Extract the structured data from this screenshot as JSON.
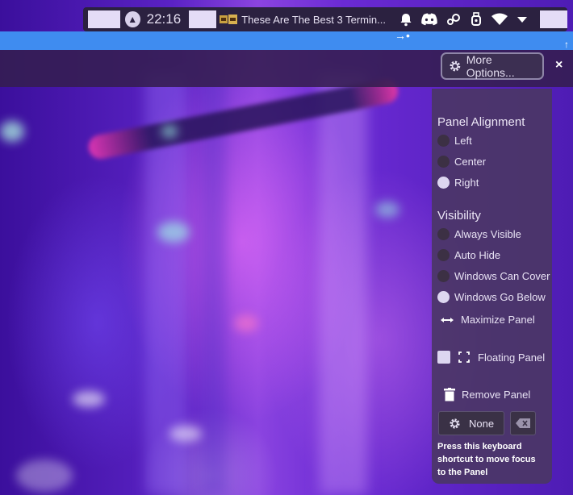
{
  "taskbar": {
    "clock": "22:16",
    "window_title": "These Are The Best 3 Termin...",
    "icons": [
      "launcher-icon",
      "notification-bell-icon",
      "discord-icon",
      "steam-icon",
      "usb-icon",
      "wifi-icon",
      "chevron-down-icon"
    ]
  },
  "toolbar": {
    "more_options_label": "More Options...",
    "close_label": "×"
  },
  "panel_options": {
    "alignment": {
      "title": "Panel Alignment",
      "options": [
        "Left",
        "Center",
        "Right"
      ],
      "selected": "Right"
    },
    "visibility": {
      "title": "Visibility",
      "options": [
        "Always Visible",
        "Auto Hide",
        "Windows Can Cover",
        "Windows Go Below"
      ],
      "selected": "Windows Go Below"
    },
    "maximize_label": "Maximize Panel",
    "floating_label": "Floating Panel",
    "floating_checked": true,
    "remove_label": "Remove Panel",
    "shortcut_value": "None",
    "shortcut_help": "Press this keyboard shortcut to move focus to the Panel"
  },
  "colors": {
    "accent_bar": "#3f8cf0",
    "panel_bg": "#4a3664"
  }
}
